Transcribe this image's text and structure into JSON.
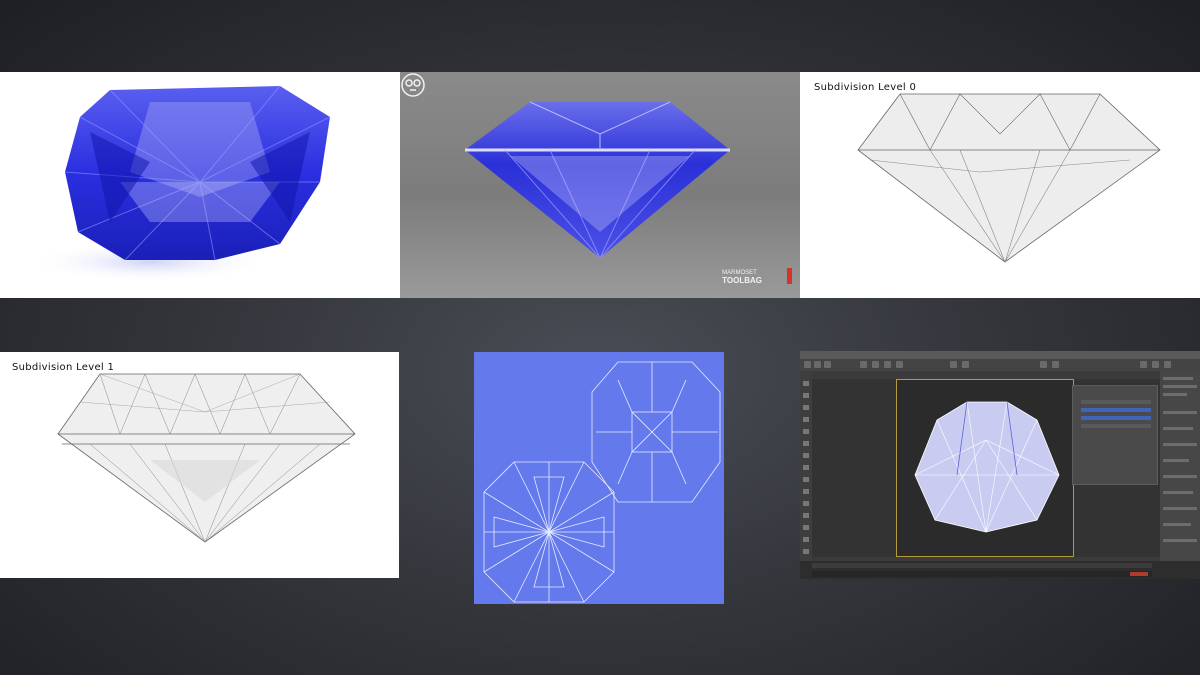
{
  "panels": {
    "subdivision_level_0_caption": "Subdivision Level 0",
    "subdivision_level_1_caption": "Subdivision Level 1",
    "marmoset_logo_line1": "MARMOSET",
    "marmoset_logo_line2": "TOOLBAG"
  },
  "colors": {
    "background": "#2e3035",
    "sapphire_blue": "#1d23d6",
    "uv_background": "#6379ec",
    "max_viewport_border": "#b49a3a"
  },
  "icons": {
    "logo": "marmoset-toolbag-logo"
  }
}
